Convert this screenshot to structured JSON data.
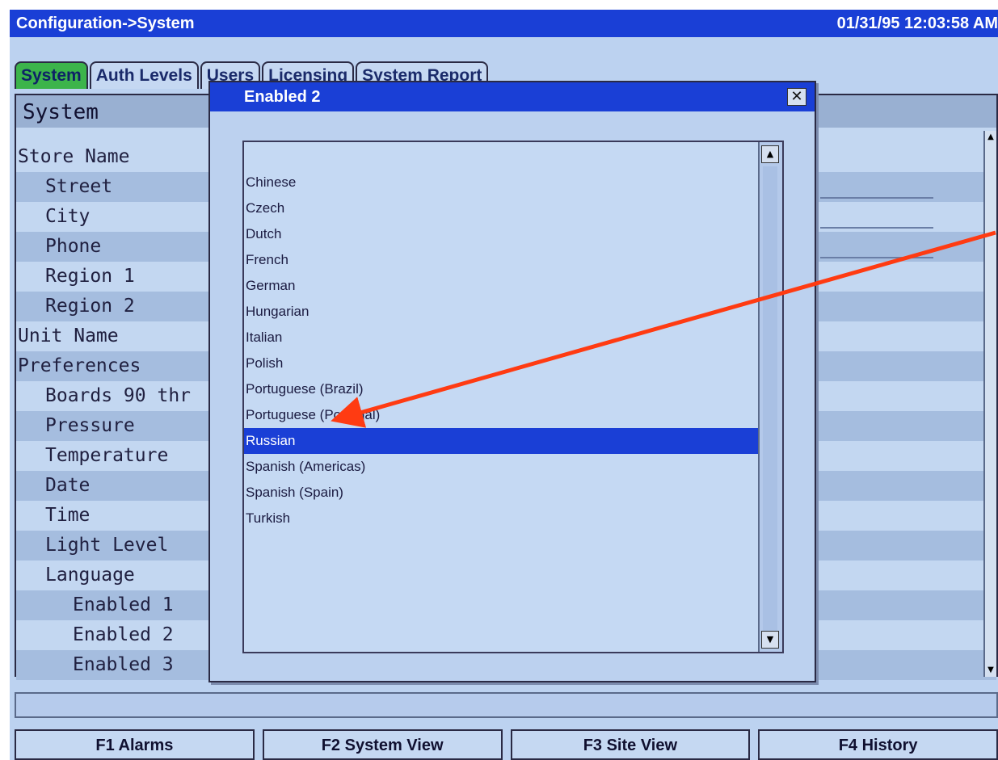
{
  "titlebar": {
    "title": "Configuration->System",
    "clock": "01/31/95 12:03:58 AM"
  },
  "tabs": [
    {
      "label": "System",
      "active": true
    },
    {
      "label": "Auth Levels",
      "active": false
    },
    {
      "label": "Users",
      "active": false
    },
    {
      "label": "Licensing",
      "active": false
    },
    {
      "label": "System Report",
      "active": false
    }
  ],
  "system_panel": {
    "header": "System",
    "rows": [
      {
        "label": "Store Name"
      },
      {
        "label": "Street"
      },
      {
        "label": "City"
      },
      {
        "label": "Phone"
      },
      {
        "label": "Region 1"
      },
      {
        "label": "Region 2"
      },
      {
        "label": "Unit Name"
      },
      {
        "label": "Preferences"
      },
      {
        "label": "Boards 90 thr"
      },
      {
        "label": "Pressure"
      },
      {
        "label": "Temperature"
      },
      {
        "label": "Date"
      },
      {
        "label": "Time"
      },
      {
        "label": "Light Level"
      },
      {
        "label": "Language"
      },
      {
        "label": "Enabled 1"
      },
      {
        "label": "Enabled 2"
      },
      {
        "label": "Enabled 3"
      }
    ]
  },
  "dialog": {
    "title": "Enabled 2",
    "close_glyph": "✕",
    "items": [
      "Chinese",
      "Czech",
      "Dutch",
      "French",
      "German",
      "Hungarian",
      "Italian",
      "Polish",
      "Portuguese (Brazil)",
      "Portuguese (Portugal)",
      "Russian",
      "Spanish (Americas)",
      "Spanish (Spain)",
      "Turkish"
    ],
    "selected": "Russian"
  },
  "function_keys": [
    {
      "label": "F1 Alarms"
    },
    {
      "label": "F2 System View"
    },
    {
      "label": "F3 Site View"
    },
    {
      "label": "F4 History"
    }
  ],
  "colors": {
    "titlebar": "#1a3fd6",
    "active_tab": "#3cb44b",
    "selection": "#1a3fd6",
    "annotation_arrow": "#ff3b12"
  },
  "icons": {
    "close": "close-icon",
    "scroll_up": "arrow-up-icon",
    "scroll_down": "arrow-down-icon"
  }
}
